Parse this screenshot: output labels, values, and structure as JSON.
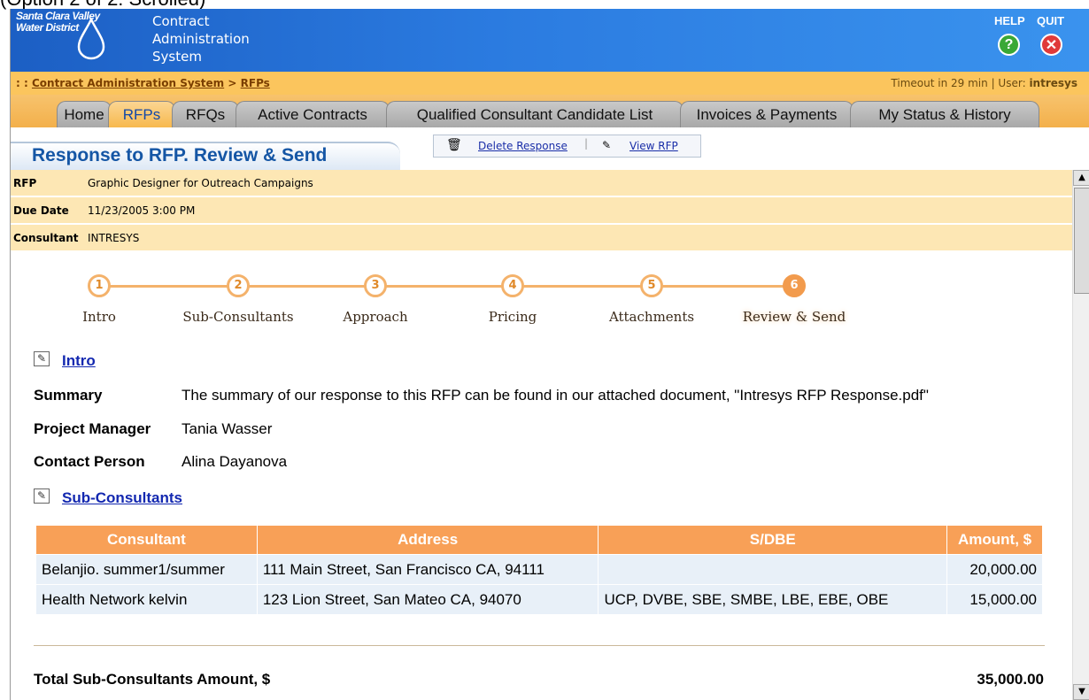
{
  "caption": "(Option 2 of 2: Scrolled)",
  "header": {
    "org_line1": "Santa Clara Valley",
    "org_line2": "Water District",
    "system_line1": "Contract",
    "system_line2": "Administration",
    "system_line3": "System",
    "help_label": "HELP",
    "quit_label": "QUIT",
    "help_icon": "question-mark-icon",
    "quit_icon": "close-x-icon"
  },
  "breadcrumb": {
    "prefix": ": :",
    "root": "Contract Administration System",
    "separator": ">",
    "current": "RFPs",
    "timeout": "Timeout in 29 min",
    "user_label": "User:",
    "user": "intresys"
  },
  "tabs": [
    {
      "label": "Home"
    },
    {
      "label": "RFPs"
    },
    {
      "label": "RFQs"
    },
    {
      "label": "Active Contracts"
    },
    {
      "label": "Qualified Consultant Candidate List"
    },
    {
      "label": "Invoices & Payments"
    },
    {
      "label": "My Status & History"
    }
  ],
  "active_tab": "RFPs",
  "page": {
    "title": "Response to RFP. Review & Send",
    "delete_label": "Delete Response",
    "view_label": "View RFP"
  },
  "info": {
    "rfp_label": "RFP",
    "rfp_value": "Graphic Designer for Outreach Campaigns",
    "due_label": "Due Date",
    "due_value": "11/23/2005 3:00 PM",
    "consultant_label": "Consultant",
    "consultant_value": "INTRESYS"
  },
  "steps": [
    {
      "num": "1",
      "label": "Intro"
    },
    {
      "num": "2",
      "label": "Sub-Consultants"
    },
    {
      "num": "3",
      "label": "Approach"
    },
    {
      "num": "4",
      "label": "Pricing"
    },
    {
      "num": "5",
      "label": "Attachments"
    },
    {
      "num": "6",
      "label": "Review & Send"
    }
  ],
  "current_step": 6,
  "intro": {
    "heading": "Intro",
    "summary_label": "Summary",
    "summary_value": "The summary of our response to this RFP can be found in our attached document, \"Intresys RFP Response.pdf\"",
    "pm_label": "Project Manager",
    "pm_value": "Tania Wasser",
    "contact_label": "Contact Person",
    "contact_value": "Alina Dayanova"
  },
  "subconsultants": {
    "heading": "Sub-Consultants",
    "columns": [
      "Consultant",
      "Address",
      "S/DBE",
      "Amount, $"
    ],
    "rows": [
      [
        "Belanjio. summer1/summer",
        "111 Main Street, San Francisco CA, 94111",
        "",
        "20,000.00"
      ],
      [
        "Health Network kelvin",
        "123 Lion Street, San Mateo CA, 94070",
        "UCP, DVBE, SBE, SMBE, LBE, EBE, OBE",
        "15,000.00"
      ]
    ],
    "total_label": "Total Sub-Consultants Amount, $",
    "total_value": "35,000.00"
  },
  "colors": {
    "header_blue": "#2b7be0",
    "accent_orange": "#f8a057",
    "info_row": "#fde7b4",
    "link_blue": "#1328b0"
  }
}
